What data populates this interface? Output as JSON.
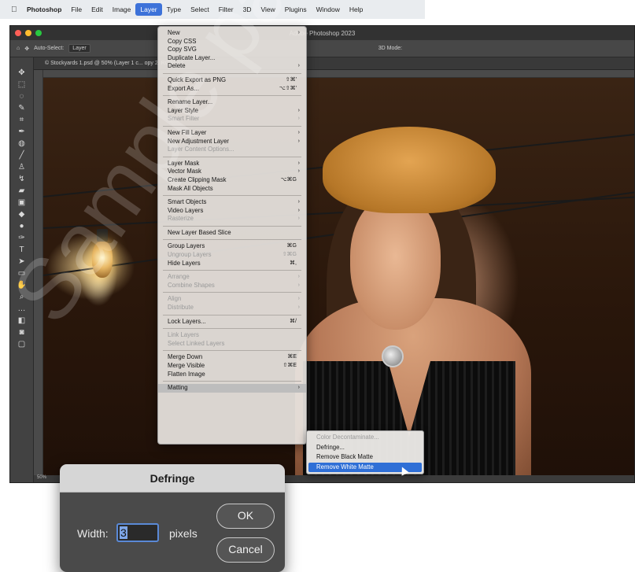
{
  "menubar": {
    "apple": "",
    "items": [
      "Photoshop",
      "File",
      "Edit",
      "Image",
      "Layer",
      "Type",
      "Select",
      "Filter",
      "3D",
      "View",
      "Plugins",
      "Window",
      "Help"
    ]
  },
  "window": {
    "title": "Adobe Photoshop 2023",
    "doc_tab": "© Stockyards 1.psd @ 50% (Layer 1 c... opy 2, RGB/8) *",
    "status": "50%",
    "options": {
      "auto_select": "Auto-Select:",
      "layer": "Layer",
      "mode3d": "3D Mode:"
    }
  },
  "watermark": "Sample pages",
  "layer_menu": {
    "items": [
      {
        "label": "New",
        "arrow": "›"
      },
      {
        "label": "Copy CSS"
      },
      {
        "label": "Copy SVG"
      },
      {
        "label": "Duplicate Layer..."
      },
      {
        "label": "Delete",
        "arrow": "›"
      },
      {
        "sep": true
      },
      {
        "label": "Quick Export as PNG",
        "shortcut": "⇧⌘'"
      },
      {
        "label": "Export As...",
        "shortcut": "⌥⇧⌘'"
      },
      {
        "sep": true
      },
      {
        "label": "Rename Layer..."
      },
      {
        "label": "Layer Style",
        "arrow": "›"
      },
      {
        "label": "Smart Filter",
        "disabled": true,
        "arrow": "›"
      },
      {
        "sep": true
      },
      {
        "label": "New Fill Layer",
        "arrow": "›"
      },
      {
        "label": "New Adjustment Layer",
        "arrow": "›"
      },
      {
        "label": "Layer Content Options...",
        "disabled": true
      },
      {
        "sep": true
      },
      {
        "label": "Layer Mask",
        "arrow": "›"
      },
      {
        "label": "Vector Mask",
        "arrow": "›"
      },
      {
        "label": "Create Clipping Mask",
        "shortcut": "⌥⌘G"
      },
      {
        "label": "Mask All Objects"
      },
      {
        "sep": true
      },
      {
        "label": "Smart Objects",
        "arrow": "›"
      },
      {
        "label": "Video Layers",
        "arrow": "›"
      },
      {
        "label": "Rasterize",
        "disabled": true,
        "arrow": "›"
      },
      {
        "sep": true
      },
      {
        "label": "New Layer Based Slice"
      },
      {
        "sep": true
      },
      {
        "label": "Group Layers",
        "shortcut": "⌘G"
      },
      {
        "label": "Ungroup Layers",
        "disabled": true,
        "shortcut": "⇧⌘G"
      },
      {
        "label": "Hide Layers",
        "shortcut": "⌘,"
      },
      {
        "sep": true
      },
      {
        "label": "Arrange",
        "disabled": true,
        "arrow": "›"
      },
      {
        "label": "Combine Shapes",
        "disabled": true,
        "arrow": "›"
      },
      {
        "sep": true
      },
      {
        "label": "Align",
        "disabled": true,
        "arrow": "›"
      },
      {
        "label": "Distribute",
        "disabled": true,
        "arrow": "›"
      },
      {
        "sep": true
      },
      {
        "label": "Lock Layers...",
        "shortcut": "⌘/"
      },
      {
        "sep": true
      },
      {
        "label": "Link Layers",
        "disabled": true
      },
      {
        "label": "Select Linked Layers",
        "disabled": true
      },
      {
        "sep": true
      },
      {
        "label": "Merge Down",
        "shortcut": "⌘E"
      },
      {
        "label": "Merge Visible",
        "shortcut": "⇧⌘E"
      },
      {
        "label": "Flatten Image"
      },
      {
        "sep": true
      },
      {
        "label": "Matting",
        "arrow": "›",
        "highlighted": true
      }
    ]
  },
  "matting_submenu": {
    "items": [
      {
        "label": "Color Decontaminate...",
        "disabled": true
      },
      {
        "label": "Defringe..."
      },
      {
        "label": "Remove Black Matte"
      },
      {
        "label": "Remove White Matte",
        "selected": true
      }
    ]
  },
  "dialog": {
    "title": "Defringe",
    "width_label": "Width:",
    "width_value": "3",
    "unit": "pixels",
    "ok": "OK",
    "cancel": "Cancel"
  },
  "colors": {
    "selection": "#2f6fd6",
    "menubar_active": "#3d72d9",
    "ps_panel": "#3a3a3a"
  }
}
